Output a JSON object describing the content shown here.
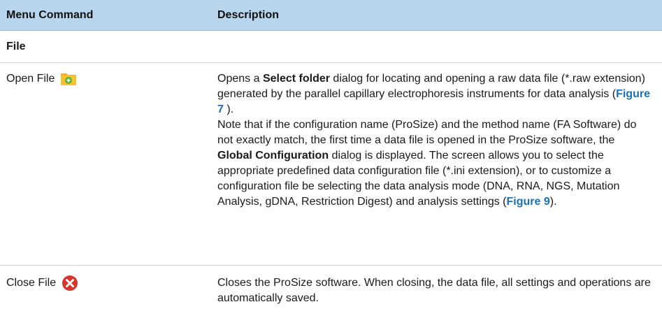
{
  "header": {
    "col_command": "Menu Command",
    "col_description": "Description"
  },
  "section": {
    "title": "File"
  },
  "rows": [
    {
      "command": "Open File",
      "icon": "folder-add-icon",
      "desc_p1_a": "Opens a ",
      "desc_p1_b": "Select folder",
      "desc_p1_c": " dialog for locating and opening a raw data file (*.raw extension) generated by the parallel capillary electrophoresis instruments for data analysis (",
      "desc_p1_link": "Figure 7",
      "desc_p1_d": " ).",
      "desc_p2_a": "Note that if the configuration name (ProSize) and the method name (FA Software) do not exactly match, the first time a data file is opened in the ProSize software, the ",
      "desc_p2_b": "Global Configuration",
      "desc_p2_c": " dialog is displayed. The screen allows you to select the appropriate predefined data configuration file (*.ini extension), or to customize a configuration file be selecting the data analysis mode (DNA, RNA, NGS, Mutation Analysis, gDNA, Restriction Digest) and analysis settings (",
      "desc_p2_link": "Figure 9",
      "desc_p2_d": ")."
    },
    {
      "command": "Close File",
      "icon": "close-circle-icon",
      "desc": "Closes the ProSize software. When closing, the data file, all settings and operations are automatically saved."
    }
  ],
  "colors": {
    "header_bg": "#b7d5ec",
    "link": "#1a6fb8",
    "folder": "#f5b417",
    "folder_plus": "#5bb33c",
    "close_red": "#d9342b"
  }
}
